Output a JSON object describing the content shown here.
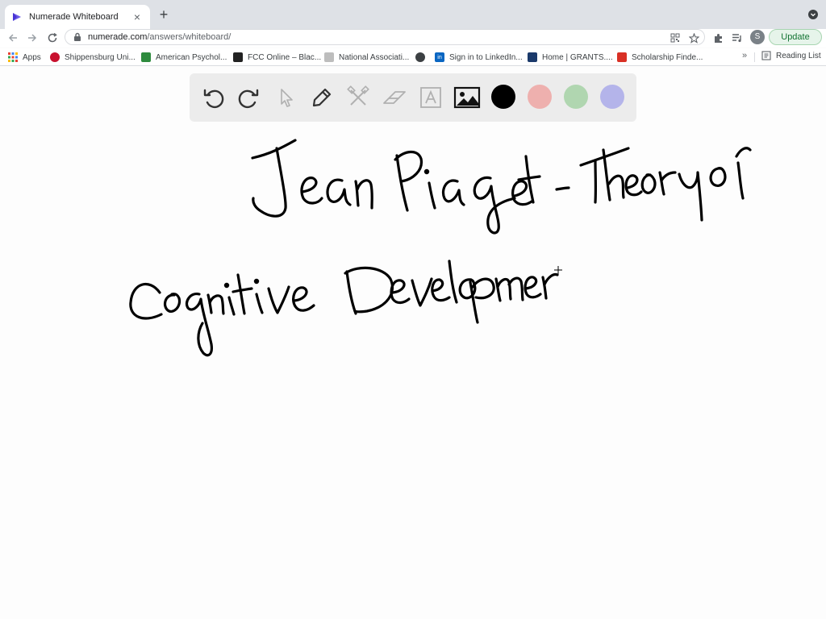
{
  "browser": {
    "tab": {
      "title": "Numerade Whiteboard",
      "favicon": "numerade-logo-icon",
      "close": "×"
    },
    "new_tab": "+",
    "url": {
      "host": "numerade.com",
      "path": "/answers/whiteboard/"
    },
    "avatar_letter": "S",
    "update_label": "Update"
  },
  "bookmarks": {
    "apps": "Apps",
    "items": [
      {
        "label": "Shippensburg Uni...",
        "color": "#c8102e"
      },
      {
        "label": "American Psychol...",
        "color": "#2e8b3e"
      },
      {
        "label": "FCC Online – Blac...",
        "color": "#222222"
      },
      {
        "label": "National Associati...",
        "color": "#8a8a8a"
      },
      {
        "label": "",
        "color": "#3c4043"
      },
      {
        "label": "Sign in to LinkedIn...",
        "color": "#0a66c2"
      },
      {
        "label": "Home | GRANTS....",
        "color": "#1b3a6b"
      },
      {
        "label": "Scholarship Finde...",
        "color": "#d93025"
      }
    ],
    "more": "»",
    "reading_list": "Reading List"
  },
  "whiteboard": {
    "tools": [
      "undo-icon",
      "redo-icon",
      "pointer-icon",
      "pen-icon",
      "tools-icon",
      "eraser-icon",
      "text-icon",
      "image-icon"
    ],
    "colors": [
      "#000000",
      "#eeb0ae",
      "#b0d6b0",
      "#b4b4ea"
    ],
    "selected_color": "#000000",
    "handwriting": [
      "Jean Piaget - Theory of",
      "Cognitive Developmen"
    ]
  }
}
